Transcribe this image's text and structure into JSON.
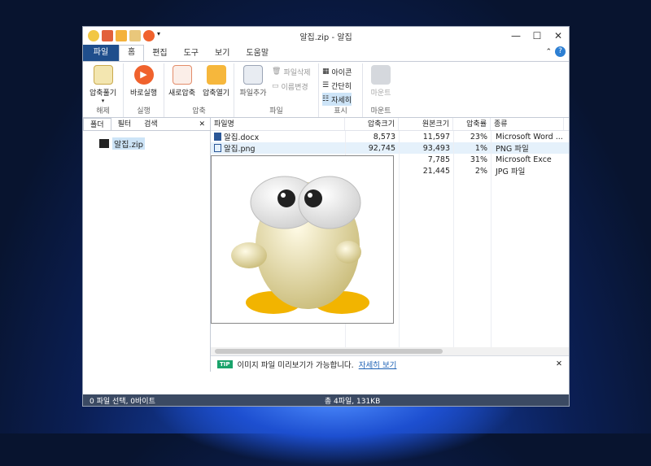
{
  "window": {
    "title": "알집.zip - 알집"
  },
  "tabs": {
    "file": "파일",
    "items": [
      "홈",
      "편집",
      "도구",
      "보기",
      "도움말"
    ]
  },
  "ribbon": {
    "groups": [
      {
        "label": "해제",
        "buttons": [
          "압축풀기"
        ]
      },
      {
        "label": "실행",
        "buttons": [
          "바로실행"
        ]
      },
      {
        "label": "압축",
        "buttons": [
          "새로압축",
          "압축열기"
        ]
      },
      {
        "label": "파일",
        "buttons": [
          "파일추가",
          "파일삭제",
          "이름변경"
        ]
      },
      {
        "label": "표시",
        "buttons": [
          "아이콘",
          "간단히",
          "자세히"
        ]
      },
      {
        "label": "마운트",
        "buttons": [
          "마운트"
        ]
      }
    ]
  },
  "left_pane": {
    "tabs": [
      "폴더",
      "필터",
      "검색"
    ],
    "tree_item": "알집.zip"
  },
  "columns": [
    "파일명",
    "압축크기",
    "원본크기",
    "압축률",
    "종류"
  ],
  "files": [
    {
      "name": "알집.docx",
      "packed": "8,573",
      "size": "11,597",
      "ratio": "23%",
      "type": "Microsoft Word ..."
    },
    {
      "name": "알집.png",
      "packed": "92,745",
      "size": "93,493",
      "ratio": "1%",
      "type": "PNG 파일"
    },
    {
      "name": "",
      "packed": "",
      "size": "7,785",
      "ratio": "31%",
      "type": "Microsoft Exce"
    },
    {
      "name": "",
      "packed": "",
      "size": "21,445",
      "ratio": "2%",
      "type": "JPG 파일"
    }
  ],
  "notice": {
    "badge": "TIP",
    "text": "이미지 파일 미리보기가 가능합니다.",
    "link": "자세히 보기"
  },
  "status": {
    "left": "0 파일 선택, 0바이트",
    "center": "총 4파일, 131KB"
  }
}
